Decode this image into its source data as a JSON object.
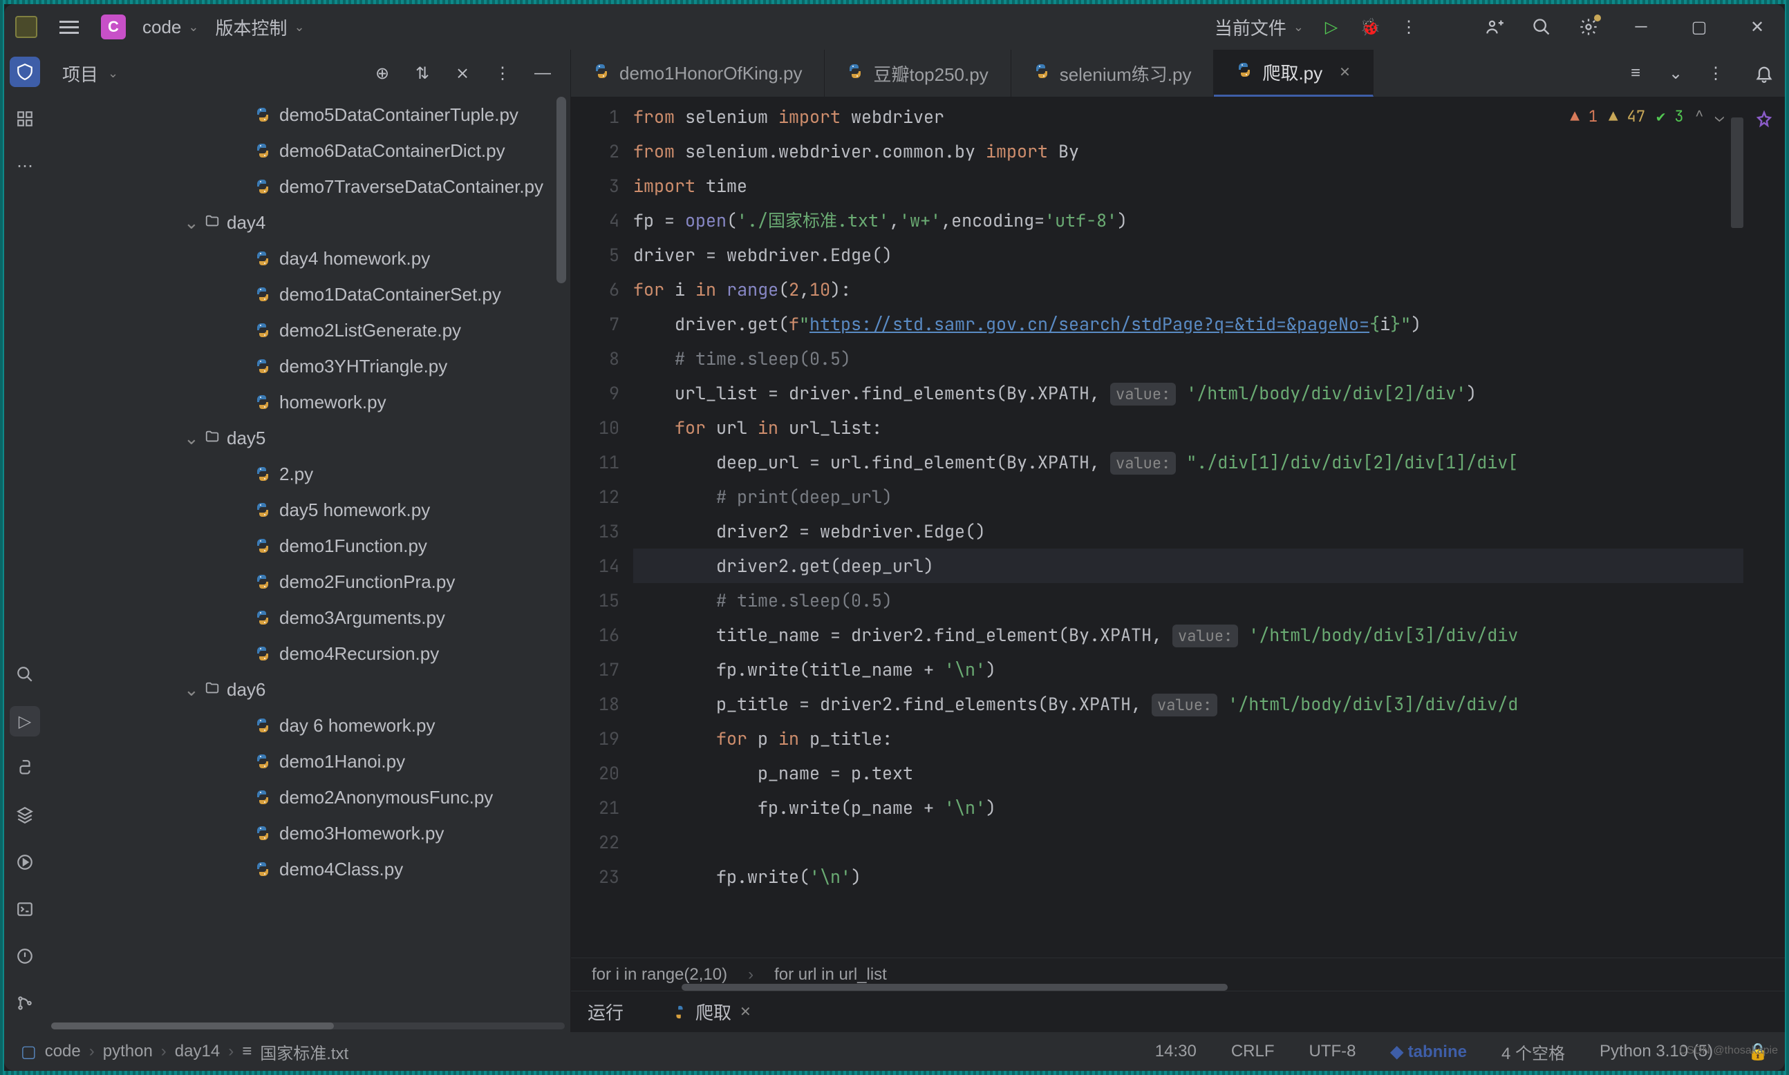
{
  "titlebar": {
    "project_letter": "C",
    "project_name": "code",
    "vcs": "版本控制",
    "run_target": "当前文件"
  },
  "sidebar": {
    "title": "项目",
    "tree": [
      {
        "type": "file",
        "name": "demo5DataContainerTuple.py",
        "indent": 3
      },
      {
        "type": "file",
        "name": "demo6DataContainerDict.py",
        "indent": 3
      },
      {
        "type": "file",
        "name": "demo7TraverseDataContainer.py",
        "indent": 3
      },
      {
        "type": "folder",
        "name": "day4",
        "indent": 1,
        "expanded": true
      },
      {
        "type": "file",
        "name": "day4 homework.py",
        "indent": 3
      },
      {
        "type": "file",
        "name": "demo1DataContainerSet.py",
        "indent": 3
      },
      {
        "type": "file",
        "name": "demo2ListGenerate.py",
        "indent": 3
      },
      {
        "type": "file",
        "name": "demo3YHTriangle.py",
        "indent": 3
      },
      {
        "type": "file",
        "name": "homework.py",
        "indent": 3
      },
      {
        "type": "folder",
        "name": "day5",
        "indent": 1,
        "expanded": true
      },
      {
        "type": "file",
        "name": "2.py",
        "indent": 3
      },
      {
        "type": "file",
        "name": "day5 homework.py",
        "indent": 3
      },
      {
        "type": "file",
        "name": "demo1Function.py",
        "indent": 3
      },
      {
        "type": "file",
        "name": "demo2FunctionPra.py",
        "indent": 3
      },
      {
        "type": "file",
        "name": "demo3Arguments.py",
        "indent": 3
      },
      {
        "type": "file",
        "name": "demo4Recursion.py",
        "indent": 3
      },
      {
        "type": "folder",
        "name": "day6",
        "indent": 1,
        "expanded": true
      },
      {
        "type": "file",
        "name": "day 6 homework.py",
        "indent": 3
      },
      {
        "type": "file",
        "name": "demo1Hanoi.py",
        "indent": 3
      },
      {
        "type": "file",
        "name": "demo2AnonymousFunc.py",
        "indent": 3
      },
      {
        "type": "file",
        "name": "demo3Homework.py",
        "indent": 3
      },
      {
        "type": "file",
        "name": "demo4Class.py",
        "indent": 3
      }
    ]
  },
  "tabs": [
    {
      "label": "demo1HonorOfKing.py",
      "active": false
    },
    {
      "label": "豆瓣top250.py",
      "active": false
    },
    {
      "label": "selenium练习.py",
      "active": false
    },
    {
      "label": "爬取.py",
      "active": true
    }
  ],
  "diag": {
    "errors": "1",
    "warnings": "47",
    "typos": "3"
  },
  "code_lines": [
    {
      "n": "1",
      "html": "<span class='kw'>from</span> selenium <span class='kw'>import</span> webdriver"
    },
    {
      "n": "2",
      "html": "<span class='kw'>from</span> selenium.webdriver.common.by <span class='kw'>import</span> By"
    },
    {
      "n": "3",
      "html": "<span class='kw'>import</span> time"
    },
    {
      "n": "4",
      "html": "fp = <span class='builtin'>open</span>(<span class='str'>'./国家标准.txt'</span>,<span class='str'>'w+'</span>,<span>encoding</span>=<span class='str'>'utf-8'</span>)"
    },
    {
      "n": "5",
      "html": "driver = webdriver.Edge()"
    },
    {
      "n": "6",
      "html": "<span class='kw'>for</span> i <span class='kw'>in</span> <span class='builtin'>range</span>(<span class='num'>2</span>,<span class='num'>10</span>):"
    },
    {
      "n": "7",
      "html": "    driver.get(<span class='kw'>f</span><span class='str'>\"</span><span class='url'>https://std.samr.gov.cn/search/stdPage?q=&tid=&pageNo=</span><span class='str'>{</span>i<span class='str'>}\"</span>)"
    },
    {
      "n": "8",
      "html": "    <span class='com'># time.sleep(0.5)</span>"
    },
    {
      "n": "9",
      "html": "    url_list = driver.find_elements(By.XPATH, <span class='hint'>value:</span> <span class='str'>'/html/body/div/div[2]/div'</span>)"
    },
    {
      "n": "10",
      "html": "    <span class='kw'>for</span> url <span class='kw'>in</span> url_list:"
    },
    {
      "n": "11",
      "html": "        deep_url = url.find_element(By.XPATH, <span class='hint'>value:</span> <span class='str'>\"./div[1]/div/div[2]/div[1]/div[</span>"
    },
    {
      "n": "12",
      "html": "        <span class='com'># print(deep_url)</span>"
    },
    {
      "n": "13",
      "html": "        driver2 = webdriver.Edge()"
    },
    {
      "n": "14",
      "html": "        driver2.get(deep_url)",
      "current": true
    },
    {
      "n": "15",
      "html": "        <span class='com'># time.sleep(0.5)</span>"
    },
    {
      "n": "16",
      "html": "        title_name = driver2.find_element(By.XPATH, <span class='hint'>value:</span> <span class='str'>'/html/body/div[3]/div/div</span>"
    },
    {
      "n": "17",
      "html": "        fp.write(title_name + <span class='str'>'\\n'</span>)"
    },
    {
      "n": "18",
      "html": "        p_title = driver2.find_elements(By.XPATH, <span class='hint'>value:</span> <span class='str'>'/html/body/div[3]/div/div/d</span>"
    },
    {
      "n": "19",
      "html": "        <span class='kw'>for</span> p <span class='kw'>in</span> p_title:"
    },
    {
      "n": "20",
      "html": "            p_name = p.text"
    },
    {
      "n": "21",
      "html": "            fp.write(p_name + <span class='str'>'\\n'</span>)"
    },
    {
      "n": "22",
      "html": ""
    },
    {
      "n": "23",
      "html": "        fp.write(<span class='str'>'\\n'</span>)"
    }
  ],
  "breadcrumb": [
    "for i in range(2,10)",
    "for url in url_list"
  ],
  "run_panel": {
    "run": "运行",
    "tab": "爬取"
  },
  "status": {
    "crumbs": [
      "code",
      "python",
      "day14",
      "国家标准.txt"
    ],
    "time": "14:30",
    "eol": "CRLF",
    "enc": "UTF-8",
    "tabnine": "tabnine",
    "indent": "4 个空格",
    "python": "Python 3.10 (5)"
  },
  "watermark": "CSDN @thosakapie"
}
